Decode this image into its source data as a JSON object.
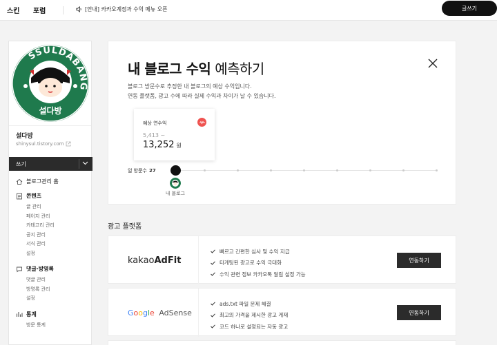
{
  "topbar": {
    "nav": [
      "스킨",
      "포럼"
    ],
    "notice": "[안내] 카카오계정과 수익 메뉴 오픈",
    "write_button": "글쓰기"
  },
  "sidebar": {
    "blog_name": "설다방",
    "blog_url": "shinysul.tistory.com",
    "write_label": "쓰기",
    "logo_text": "설다방",
    "logo_ring_text": "SSULDABANG",
    "groups": [
      {
        "title": "블로그관리 홈",
        "items": []
      },
      {
        "title": "콘텐츠",
        "items": [
          "글 관리",
          "페이지 관리",
          "카테고리 관리",
          "공지 관리",
          "서식 관리",
          "설정"
        ]
      },
      {
        "title": "댓글·방명록",
        "items": [
          "댓글 관리",
          "방명록 관리",
          "설정"
        ]
      },
      {
        "title": "통계",
        "items": [
          "방문 통계"
        ]
      }
    ]
  },
  "revenue": {
    "title_bold": "내 블로그 수익",
    "title_light": "예측하기",
    "desc_line1": "블로그 방문수로 추정한 내 블로그의 예상 수익입니다.",
    "desc_line2": "연동 플랫폼, 광고 수에 따라 실제 수익과 차이가 날 수 있습니다.",
    "box_label": "예상 연수익",
    "from_value": "5,413 ~",
    "to_value": "13,252",
    "unit": "원",
    "visits_label": "일 방문수",
    "visits_value": "27",
    "my_blog_label": "내 블로그",
    "slider_fraction": 0.0
  },
  "platforms": {
    "section_title": "광고 플랫폼",
    "items": [
      {
        "logo_prefix": "kakao",
        "logo_main": "AdFit",
        "features": [
          "빠르고 간편한 심사 및 수익 지급",
          "타게팅된 광고로 수익 극대화",
          "수익 관련 정보 카카오톡 알림 설정 가능"
        ],
        "button": "연동하기"
      },
      {
        "logo_google": [
          "G",
          "o",
          "o",
          "g",
          "l",
          "e"
        ],
        "logo_main": "AdSense",
        "features": [
          "ads.txt 파일 문제 해결",
          "최고의 가격을 제시한 광고 게재",
          "코드 하나로 설정되는 자동 광고"
        ],
        "button": "연동하기"
      }
    ]
  },
  "colors": {
    "accent_red": "#ef5350",
    "logo_green": "#1f7a4d",
    "dark": "#2b2b2b"
  }
}
